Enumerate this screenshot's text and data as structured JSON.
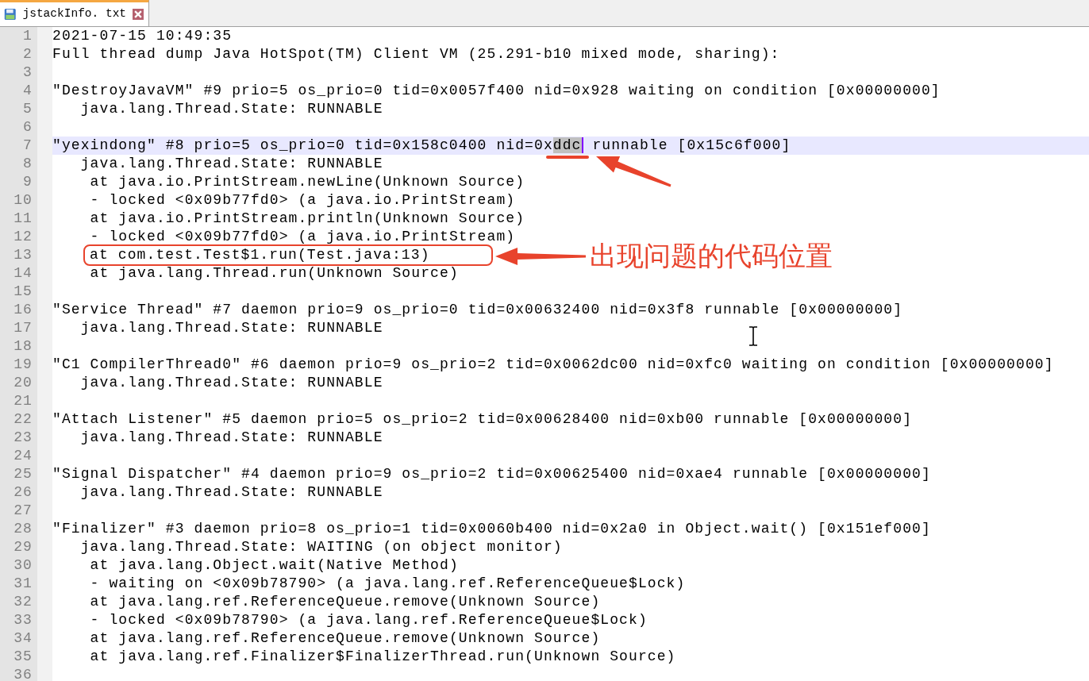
{
  "tab": {
    "title": "jstackInfo. txt",
    "selected": true
  },
  "lines": [
    {
      "number": "1",
      "text": "2021-07-15 10:49:35",
      "current": false
    },
    {
      "number": "2",
      "text": "Full thread dump Java HotSpot(TM) Client VM (25.291-b10 mixed mode, sharing):",
      "current": false
    },
    {
      "number": "3",
      "current": false
    },
    {
      "number": "4",
      "text": "\"DestroyJavaVM\" #9 prio=5 os_prio=0 tid=0x0057f400 nid=0x928 waiting on condition [0x00000000]",
      "current": false
    },
    {
      "number": "5",
      "text": "   java.lang.Thread.State: RUNNABLE",
      "current": false
    },
    {
      "number": "6",
      "current": false
    },
    {
      "number": "7",
      "text": "\"yexindong\" #8 prio=5 os_prio=0 tid=0x158c0400 nid=0x",
      "selected_text": "ddc",
      "text_after": " runnable [0x15c6f000]",
      "current": true
    },
    {
      "number": "8",
      "text": "   java.lang.Thread.State: RUNNABLE",
      "current": false
    },
    {
      "number": "9",
      "text": "    at java.io.PrintStream.newLine(Unknown Source)",
      "current": false
    },
    {
      "number": "10",
      "text": "    - locked <0x09b77fd0> (a java.io.PrintStream)",
      "current": false
    },
    {
      "number": "11",
      "text": "    at java.io.PrintStream.println(Unknown Source)",
      "current": false
    },
    {
      "number": "12",
      "text": "    - locked <0x09b77fd0> (a java.io.PrintStream)",
      "current": false
    },
    {
      "number": "13",
      "text": "    at com.test.Test$1.run(Test.java:13)",
      "current": false
    },
    {
      "number": "14",
      "text": "    at java.lang.Thread.run(Unknown Source)",
      "current": false
    },
    {
      "number": "15",
      "current": false
    },
    {
      "number": "16",
      "text": "\"Service Thread\" #7 daemon prio=9 os_prio=0 tid=0x00632400 nid=0x3f8 runnable [0x00000000]",
      "current": false
    },
    {
      "number": "17",
      "text": "   java.lang.Thread.State: RUNNABLE",
      "current": false
    },
    {
      "number": "18",
      "current": false
    },
    {
      "number": "19",
      "text": "\"C1 CompilerThread0\" #6 daemon prio=9 os_prio=2 tid=0x0062dc00 nid=0xfc0 waiting on condition [0x00000000]",
      "current": false
    },
    {
      "number": "20",
      "text": "   java.lang.Thread.State: RUNNABLE",
      "current": false
    },
    {
      "number": "21",
      "current": false
    },
    {
      "number": "22",
      "text": "\"Attach Listener\" #5 daemon prio=5 os_prio=2 tid=0x00628400 nid=0xb00 runnable [0x00000000]",
      "current": false
    },
    {
      "number": "23",
      "text": "   java.lang.Thread.State: RUNNABLE",
      "current": false
    },
    {
      "number": "24",
      "current": false
    },
    {
      "number": "25",
      "text": "\"Signal Dispatcher\" #4 daemon prio=9 os_prio=2 tid=0x00625400 nid=0xae4 runnable [0x00000000]",
      "current": false
    },
    {
      "number": "26",
      "text": "   java.lang.Thread.State: RUNNABLE",
      "current": false
    },
    {
      "number": "27",
      "current": false
    },
    {
      "number": "28",
      "text": "\"Finalizer\" #3 daemon prio=8 os_prio=1 tid=0x0060b400 nid=0x2a0 in Object.wait() [0x151ef000]",
      "current": false
    },
    {
      "number": "29",
      "text": "   java.lang.Thread.State: WAITING (on object monitor)",
      "current": false
    },
    {
      "number": "30",
      "text": "    at java.lang.Object.wait(Native Method)",
      "current": false
    },
    {
      "number": "31",
      "text": "    - waiting on <0x09b78790> (a java.lang.ref.ReferenceQueue$Lock)",
      "current": false
    },
    {
      "number": "32",
      "text": "    at java.lang.ref.ReferenceQueue.remove(Unknown Source)",
      "current": false
    },
    {
      "number": "33",
      "text": "    - locked <0x09b78790> (a java.lang.ref.ReferenceQueue$Lock)",
      "current": false
    },
    {
      "number": "34",
      "text": "    at java.lang.ref.ReferenceQueue.remove(Unknown Source)",
      "current": false
    },
    {
      "number": "35",
      "text": "    at java.lang.ref.Finalizer$FinalizerThread.run(Unknown Source)",
      "current": false
    },
    {
      "number": "36",
      "current": false
    }
  ],
  "annotations": [
    {
      "kind": "underline"
    },
    {
      "kind": "arrow"
    },
    {
      "kind": "box"
    },
    {
      "kind": "arrow"
    },
    {
      "kind": "label",
      "text": "出现问题的代码位置"
    }
  ]
}
